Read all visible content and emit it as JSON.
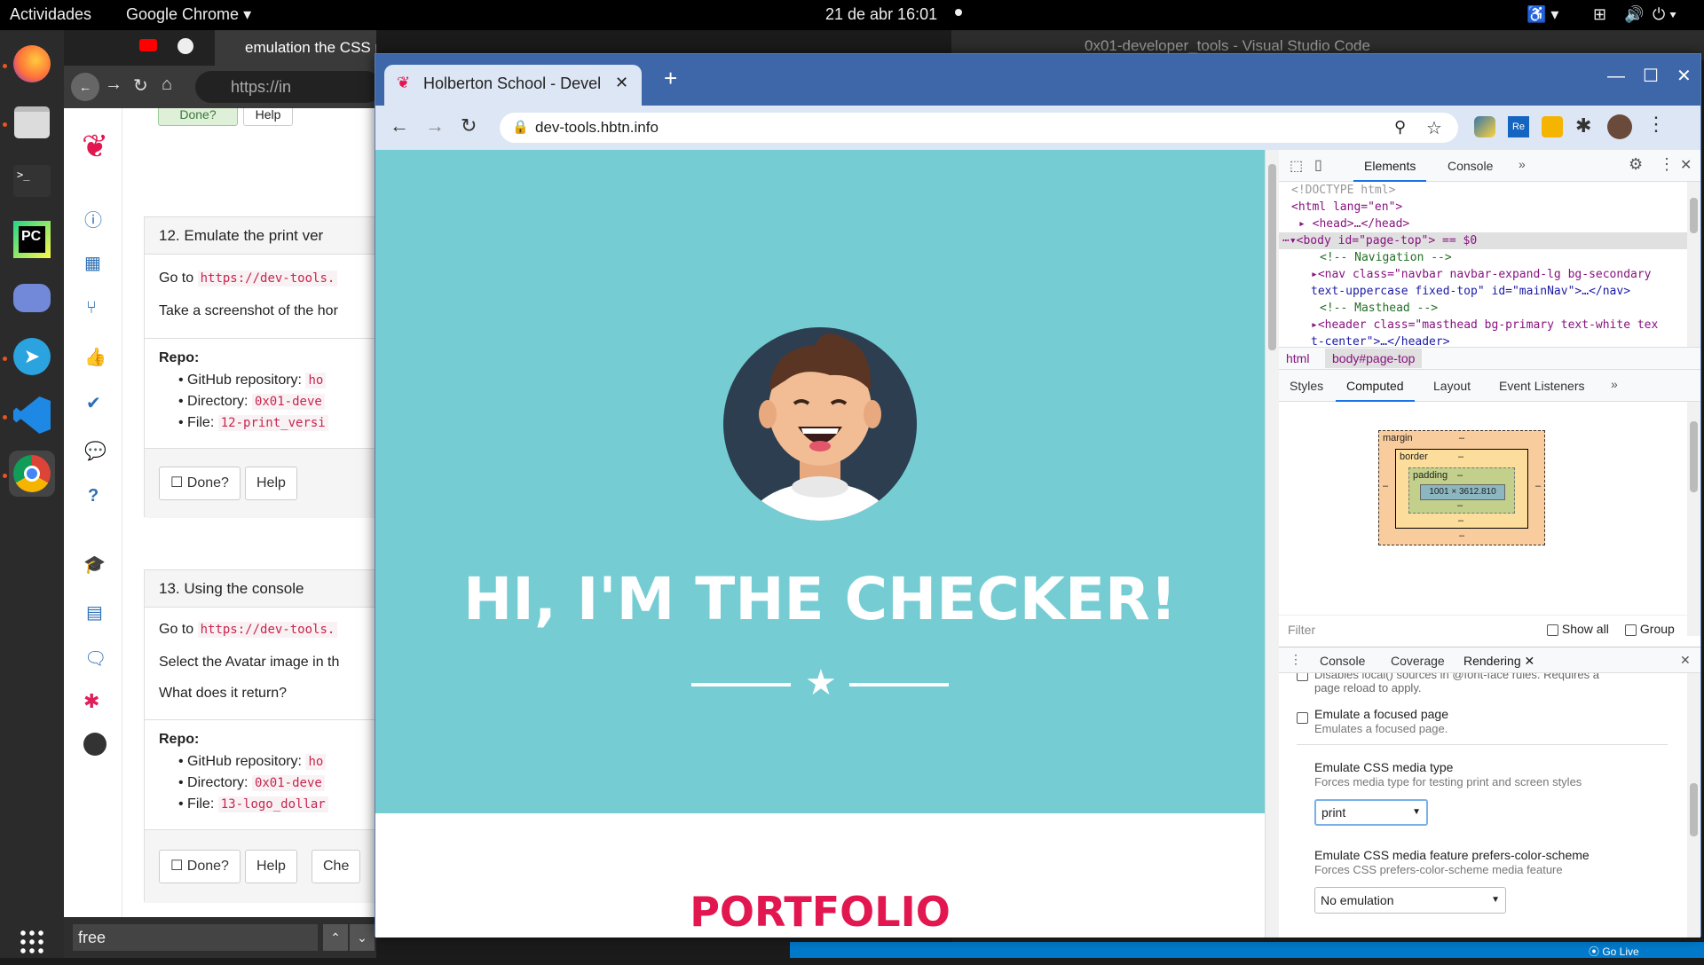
{
  "topbar": {
    "activities": "Actividades",
    "app": "Google Chrome",
    "clock": "21 de abr  16:01"
  },
  "bg_chrome": {
    "url": "https://in",
    "find_text": "free",
    "task12": {
      "title": "12. Emulate the print ver",
      "goto": "Go to",
      "url": "https://dev-tools.",
      "desc": "Take a screenshot of the hor",
      "repo": "Repo:",
      "gh_label": "GitHub repository:",
      "gh_val": "ho",
      "dir_label": "Directory:",
      "dir_val": "0x01-deve",
      "file_label": "File:",
      "file_val": "12-print_versi",
      "done": "Done?",
      "help": "Help"
    },
    "task13": {
      "title": "13. Using the console",
      "goto": "Go to",
      "url": "https://dev-tools.",
      "desc1": "Select the Avatar image in th",
      "desc2": "What does it return?",
      "repo": "Repo:",
      "gh_label": "GitHub repository:",
      "gh_val": "ho",
      "dir_label": "Directory:",
      "dir_val": "0x01-deve",
      "file_label": "File:",
      "file_val": "13-logo_dollar",
      "done": "Done?",
      "help": "Help",
      "check": "Che"
    },
    "prev_done": "Done?",
    "prev_help": "Help",
    "bg_tab_title": "emulation the CSS print"
  },
  "vscode": {
    "title": "0x01-developer_tools - Visual Studio Code",
    "status": "Go Live"
  },
  "window": {
    "tab_title": "Holberton School - Develo",
    "url": "dev-tools.hbtn.info",
    "hero_title": "HI, I'M THE CHECKER!",
    "portfolio": "PORTFOLIO",
    "hero_color": "#75cdd3",
    "accent": "#e2174f"
  },
  "devtools": {
    "tabs": [
      "Elements",
      "Console"
    ],
    "dom": {
      "doctype": "<!DOCTYPE html>",
      "html_open": "<html lang=\"en\">",
      "head": "<head>…</head>",
      "body": "<body id=\"page-top\"> == $0",
      "comment1": "<!-- Navigation -->",
      "nav_l1": "<nav class=\"navbar navbar-expand-lg bg-secondary",
      "nav_l2": "text-uppercase fixed-top\" id=\"mainNav\">…</nav>",
      "comment2": "<!-- Masthead -->",
      "header_l1": "<header class=\"masthead bg-primary text-white tex",
      "header_l2": "t-center\">…</header>"
    },
    "breadcrumb": [
      "html",
      "body#page-top"
    ],
    "subtabs": [
      "Styles",
      "Computed",
      "Layout",
      "Event Listeners"
    ],
    "boxmodel": {
      "margin": "margin",
      "border": "border",
      "padding": "padding",
      "content": "1001 × 3612.810",
      "dash": "–"
    },
    "filter": "Filter",
    "show_all": "Show all",
    "group": "Group",
    "drawer_tabs": [
      "Console",
      "Coverage",
      "Rendering"
    ],
    "rendering": {
      "cut_text1": "Disables local() sources in @font-face rules. Requires a",
      "cut_text2": "page reload to apply.",
      "focus_title": "Emulate a focused page",
      "focus_desc": "Emulates a focused page.",
      "media_title": "Emulate CSS media type",
      "media_desc": "Forces media type for testing print and screen styles",
      "media_value": "print",
      "scheme_title": "Emulate CSS media feature prefers-color-scheme",
      "scheme_desc": "Forces CSS prefers-color-scheme media feature",
      "scheme_value": "No emulation"
    }
  }
}
